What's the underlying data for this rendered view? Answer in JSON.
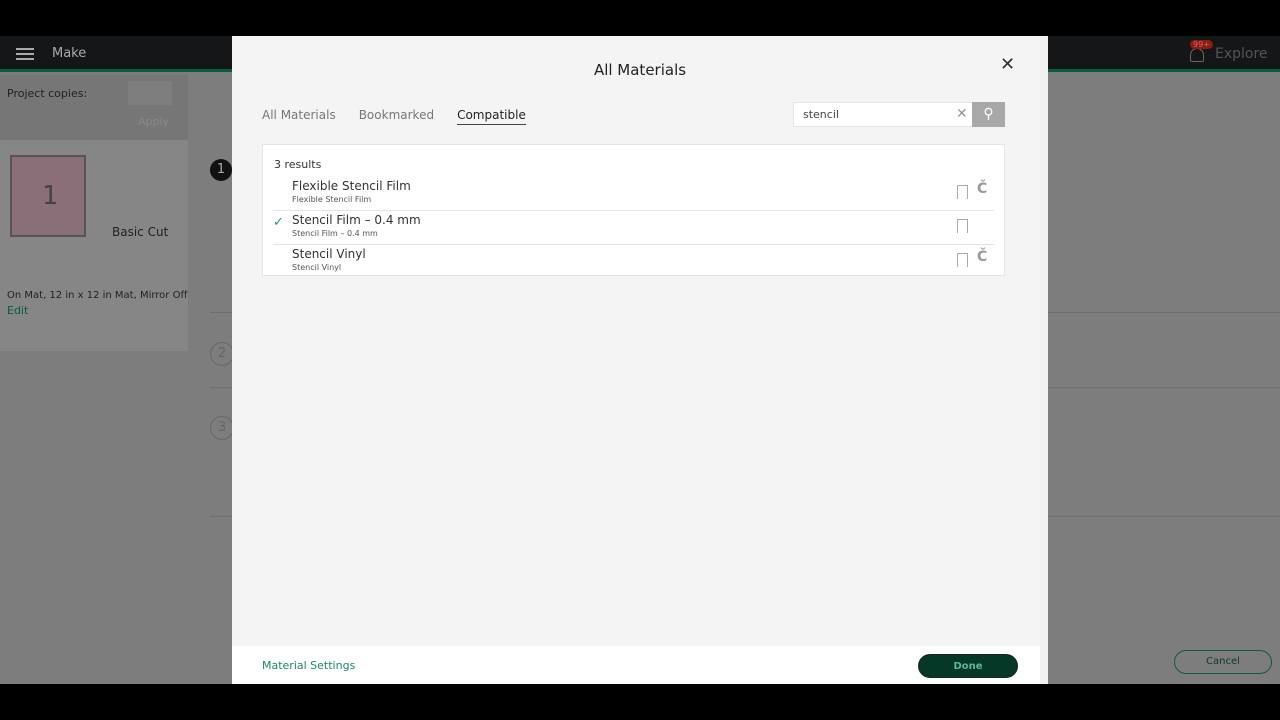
{
  "app": {
    "menu_label": "Make",
    "notification_badge": "99+",
    "explore": "Explore"
  },
  "left": {
    "project_copies": "Project copies:",
    "apply": "Apply",
    "mat_number": "1",
    "mat_name": "Basic Cut",
    "mat_info": "On Mat, 12 in x 12 in Mat, Mirror Off",
    "edit": "Edit",
    "steps": [
      "1",
      "2",
      "3"
    ],
    "cancel": "Cancel"
  },
  "modal": {
    "title": "All Materials",
    "tabs": [
      {
        "label": "All Materials"
      },
      {
        "label": "Bookmarked"
      },
      {
        "label": "Compatible",
        "active": true
      }
    ],
    "search": {
      "value": "stencil"
    },
    "results_count": "3 results",
    "results": [
      {
        "name": "Flexible Stencil Film",
        "sub": "Flexible Stencil Film",
        "selected": false
      },
      {
        "name": "Stencil Film – 0.4 mm",
        "sub": "Stencil Film – 0.4 mm",
        "selected": true
      },
      {
        "name": "Stencil Vinyl",
        "sub": "Stencil Vinyl",
        "selected": false
      }
    ],
    "material_settings": "Material Settings",
    "done": "Done"
  }
}
